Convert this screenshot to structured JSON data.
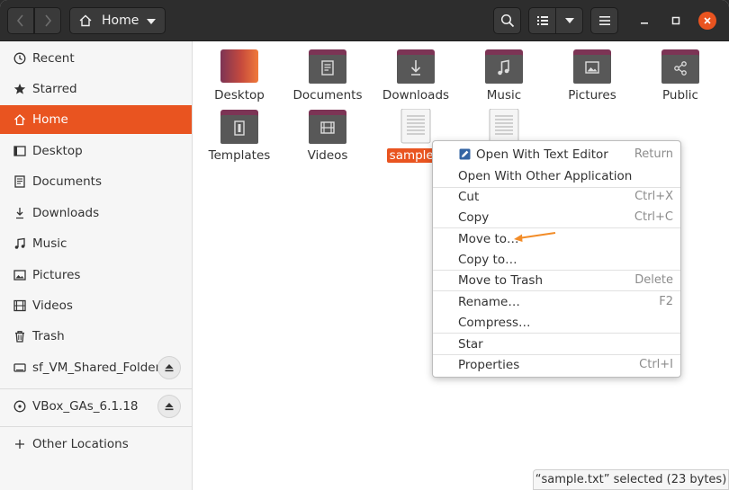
{
  "header": {
    "path_label": "Home"
  },
  "sidebar": {
    "items": [
      {
        "label": "Recent",
        "icon": "clock-icon"
      },
      {
        "label": "Starred",
        "icon": "star-icon"
      },
      {
        "label": "Home",
        "icon": "home-icon",
        "active": true
      },
      {
        "label": "Desktop",
        "icon": "desktop-icon"
      },
      {
        "label": "Documents",
        "icon": "document-icon"
      },
      {
        "label": "Downloads",
        "icon": "download-icon"
      },
      {
        "label": "Music",
        "icon": "music-icon"
      },
      {
        "label": "Pictures",
        "icon": "picture-icon"
      },
      {
        "label": "Videos",
        "icon": "video-icon"
      },
      {
        "label": "Trash",
        "icon": "trash-icon"
      },
      {
        "label": "sf_VM_Shared_Folder",
        "icon": "drive-icon"
      },
      {
        "label": "VBox_GAs_6.1.18",
        "icon": "disc-icon"
      },
      {
        "label": "Other Locations",
        "icon": "plus-icon"
      }
    ]
  },
  "files": [
    {
      "label": "Desktop"
    },
    {
      "label": "Documents"
    },
    {
      "label": "Downloads"
    },
    {
      "label": "Music"
    },
    {
      "label": "Pictures"
    },
    {
      "label": "Public"
    },
    {
      "label": "Templates"
    },
    {
      "label": "Videos"
    },
    {
      "label": "sample.t"
    }
  ],
  "context_menu": {
    "items": [
      {
        "label": "Open With Text Editor",
        "accel": "Return"
      },
      {
        "label": "Open With Other Application",
        "accel": ""
      },
      {
        "label": "Cut",
        "accel": "Ctrl+X"
      },
      {
        "label": "Copy",
        "accel": "Ctrl+C"
      },
      {
        "label": "Move to…",
        "accel": ""
      },
      {
        "label": "Copy to…",
        "accel": ""
      },
      {
        "label": "Move to Trash",
        "accel": "Delete"
      },
      {
        "label": "Rename…",
        "accel": "F2"
      },
      {
        "label": "Compress…",
        "accel": ""
      },
      {
        "label": "Star",
        "accel": ""
      },
      {
        "label": "Properties",
        "accel": "Ctrl+I"
      }
    ]
  },
  "status": {
    "text": "“sample.txt” selected  (23 bytes)"
  },
  "colors": {
    "accent": "#e95420",
    "headerbar": "#2d2d2d",
    "folder_top": "#7c3455",
    "folder_body": "#585858"
  }
}
